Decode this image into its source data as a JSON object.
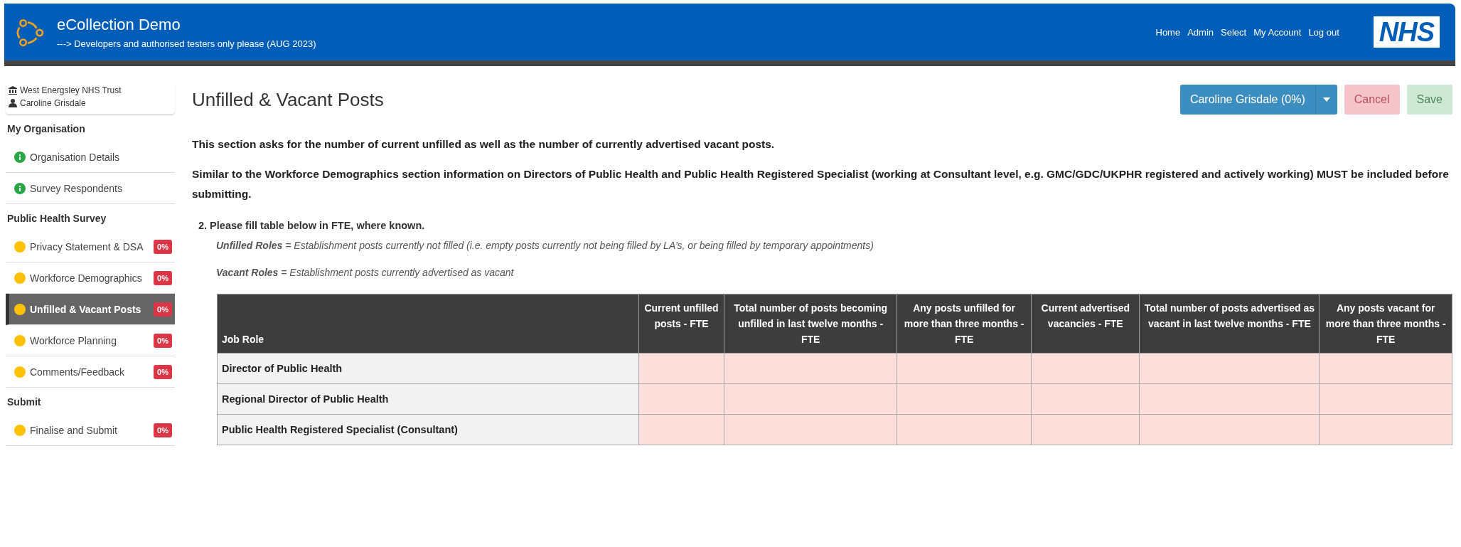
{
  "header": {
    "title": "eCollection Demo",
    "subtitle": "---> Developers and authorised testers only please (AUG 2023)",
    "nav": [
      "Home",
      "Admin",
      "Select",
      "My Account",
      "Log out"
    ],
    "logo": "NHS"
  },
  "sidebar": {
    "organisation": "West Energsley NHS Trust",
    "user": "Caroline Grisdale",
    "sections": [
      {
        "title": "My Organisation",
        "items": [
          {
            "label": "Organisation Details",
            "kind": "info",
            "selected": false
          },
          {
            "label": "Survey Respondents",
            "kind": "info",
            "selected": false
          }
        ]
      },
      {
        "title": "Public Health Survey",
        "items": [
          {
            "label": "Privacy Statement & DSA",
            "kind": "progress",
            "badge": "0%",
            "selected": false
          },
          {
            "label": "Workforce Demographics",
            "kind": "progress",
            "badge": "0%",
            "selected": false
          },
          {
            "label": "Unfilled & Vacant Posts",
            "kind": "progress",
            "badge": "0%",
            "selected": true
          },
          {
            "label": "Workforce Planning",
            "kind": "progress",
            "badge": "0%",
            "selected": false
          },
          {
            "label": "Comments/Feedback",
            "kind": "progress",
            "badge": "0%",
            "selected": false
          }
        ]
      },
      {
        "title": "Submit",
        "items": [
          {
            "label": "Finalise and Submit",
            "kind": "progress",
            "badge": "0%",
            "selected": false
          }
        ]
      }
    ]
  },
  "page": {
    "title": "Unfilled & Vacant Posts",
    "user_button": "Caroline Grisdale (0%)",
    "buttons": [
      {
        "label": "Cancel",
        "kind": "cancel",
        "disabled": true
      },
      {
        "label": "Save",
        "kind": "save",
        "disabled": true
      }
    ],
    "intro": [
      "This section asks for the number of current unfilled as well as the number of currently advertised vacant posts.",
      "Similar to the Workforce Demographics section information on Directors of Public Health and Public Health Registered Specialist (working at Consultant level, e.g. GMC/GDC/UKPHR registered and actively working) MUST be included before submitting."
    ],
    "question": "2. Please fill table below in FTE, where known.",
    "definitions": [
      "**Unfilled Roles** = Establishment posts currently not filled (i.e. empty posts currently not being filled by LA’s, or being filled by temporary appointments)",
      "**Vacant Roles** = Establishment posts currently advertised as vacant"
    ],
    "table": {
      "columns": [
        "Job Role",
        "Current unfilled posts - FTE",
        "Total number of posts becoming unfilled in last twelve months - FTE",
        "Any posts unfilled for more than three months - FTE",
        "Current advertised vacancies - FTE",
        "Total number of posts advertised as vacant in last twelve months - FTE",
        "Any posts vacant for more than three months - FTE"
      ],
      "rows": [
        {
          "role": "Director of Public Health"
        },
        {
          "role": "Regional Director of Public Health"
        },
        {
          "role": "Public Health Registered Specialist (Consultant)"
        }
      ]
    }
  }
}
